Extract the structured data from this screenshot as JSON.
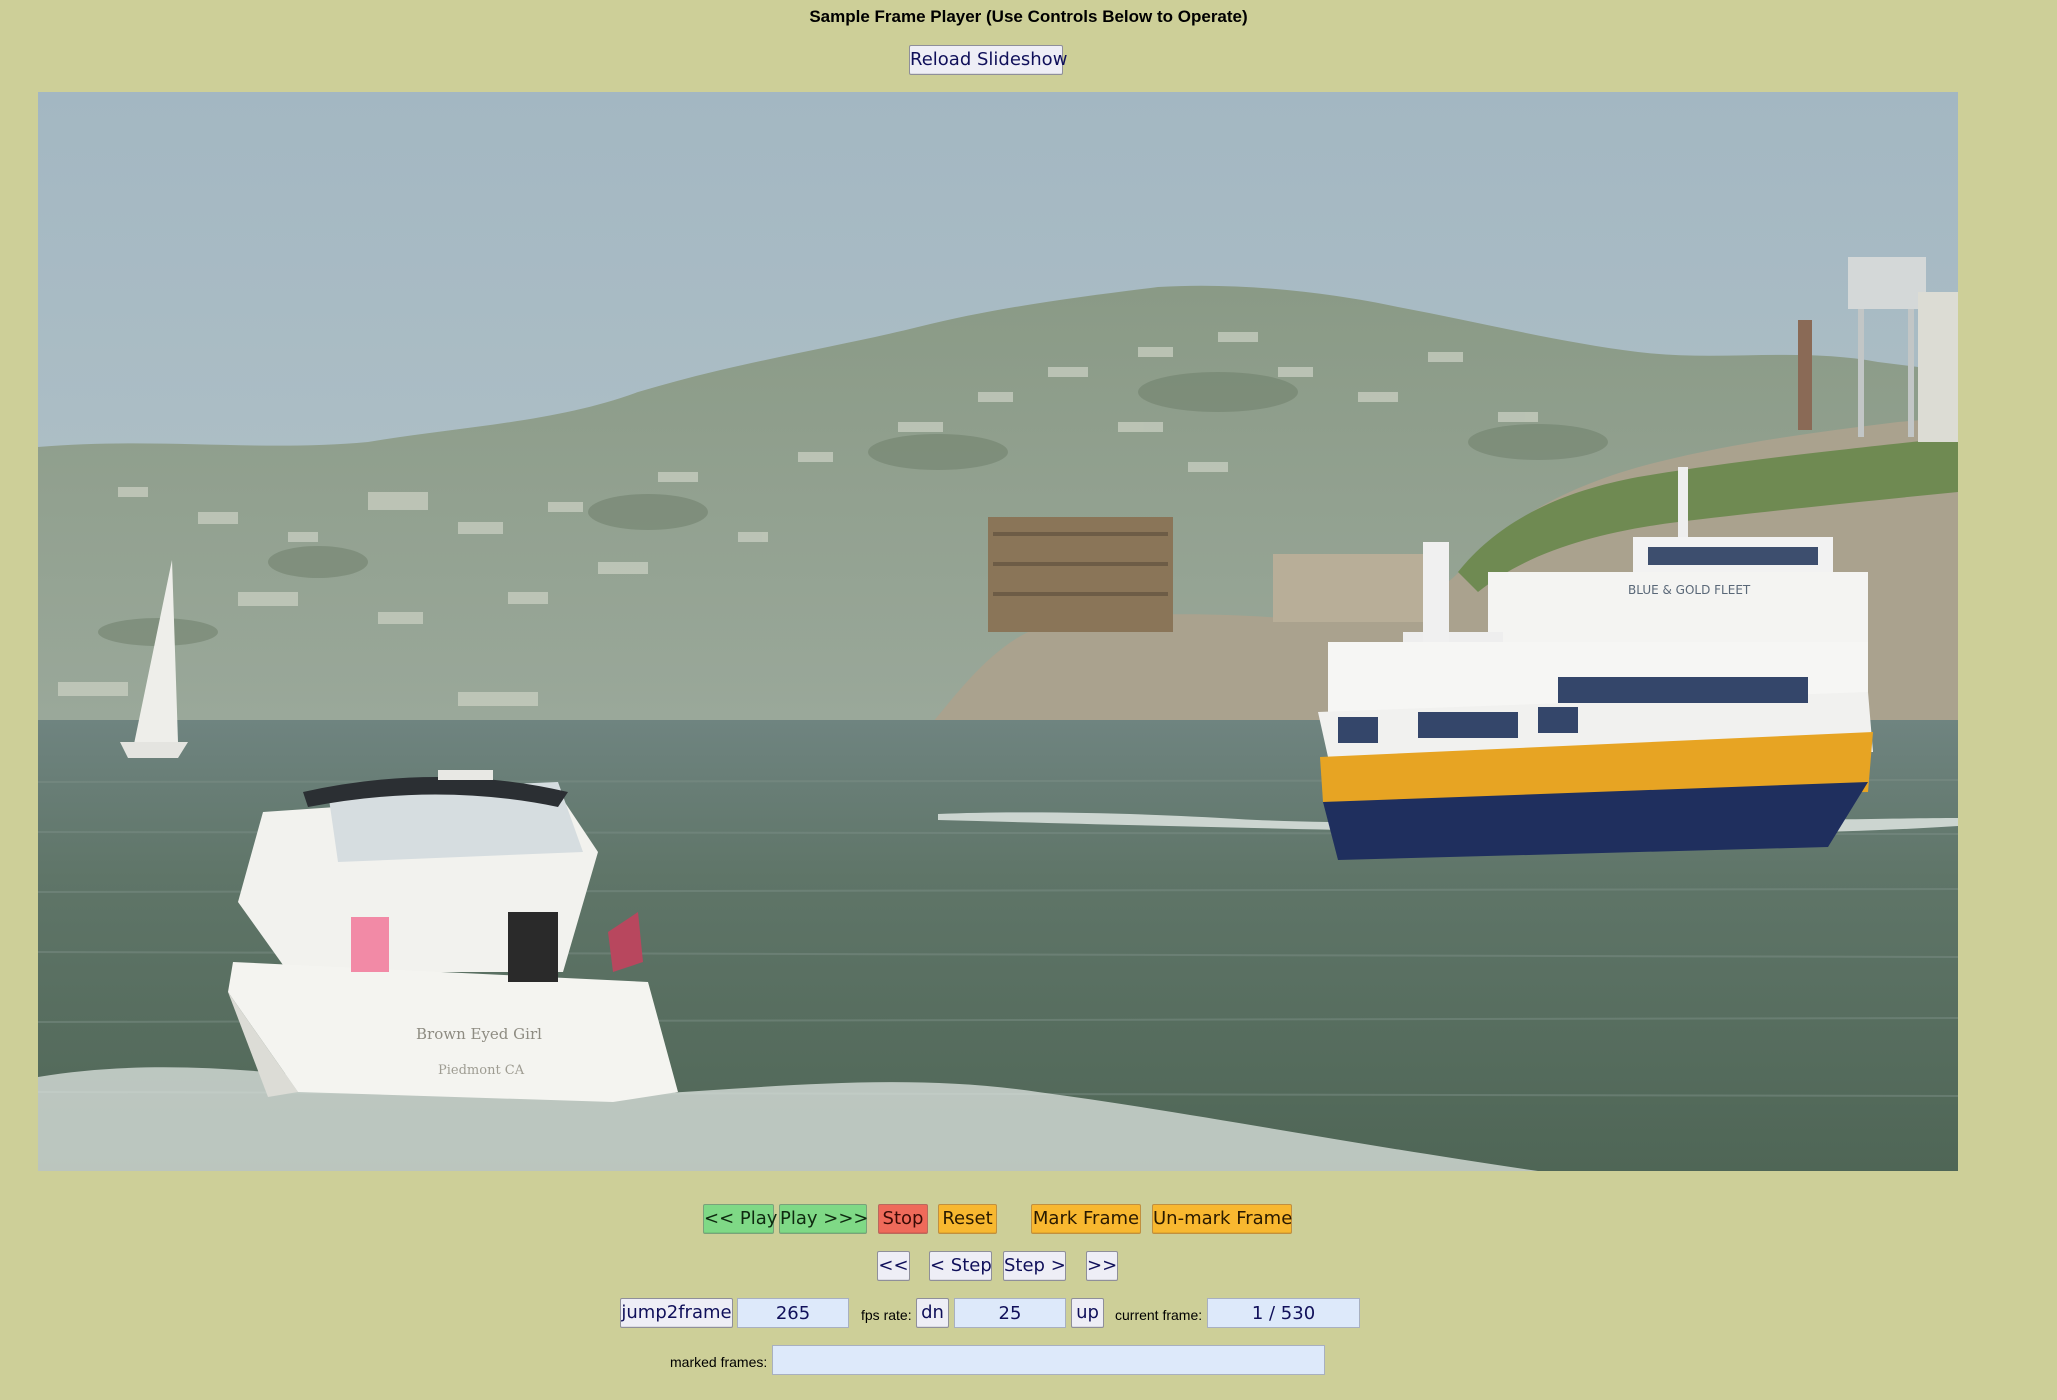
{
  "header": {
    "title": "Sample Frame Player (Use Controls Below to Operate)",
    "reload_label": "Reload Slideshow"
  },
  "frame": {
    "content": "Harbor scene: small white motor cruiser and a Blue & Gold Fleet ferry on the bay, island with buildings and a hillside town behind",
    "boat_name_text": "Brown Eyed Girl",
    "boat_home_text": "Piedmont CA",
    "ferry_livery_text": "BLUE & GOLD FLEET",
    "colors": {
      "sky": "#a9bcc6",
      "water": "#5d7468",
      "ferry_hull": "#1f2f5e",
      "ferry_stripe": "#e7a423"
    }
  },
  "controls": {
    "row1": {
      "play_back": "<< Play",
      "play_forward": "Play >>>",
      "stop": "Stop",
      "reset": "Reset",
      "mark": "Mark Frame",
      "unmark": "Un-mark Frame"
    },
    "row2": {
      "first": "<<",
      "step_back": "< Step",
      "step_forward": "Step >",
      "last": ">>"
    },
    "row3": {
      "jump_label": "jump2frame",
      "jump_value": "265",
      "fps_label": "fps rate:",
      "fps_down": "dn",
      "fps_value": "25",
      "fps_up": "up",
      "current_label": "current frame:",
      "current_value": "1 / 530"
    },
    "row4": {
      "marked_label": "marked frames:",
      "marked_value": ""
    }
  },
  "colors": {
    "page_background": "#cdcf98",
    "play": "#7fd986",
    "stop": "#ef6a5a",
    "action": "#f8b830",
    "field": "#dde9fa"
  }
}
